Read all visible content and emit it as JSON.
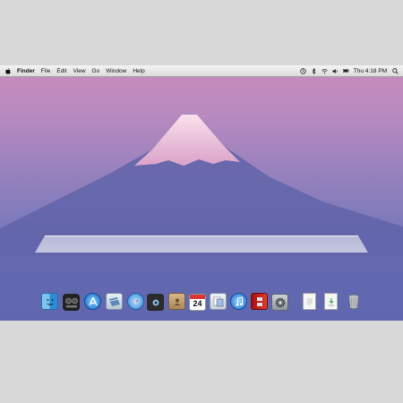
{
  "menubar": {
    "app_name": "Finder",
    "items": [
      "File",
      "Edit",
      "View",
      "Go",
      "Window",
      "Help"
    ],
    "clock": "Thu 4:18 PM"
  },
  "status_icons": [
    "time-machine-icon",
    "bluetooth-icon",
    "wifi-icon",
    "volume-icon",
    "battery-icon",
    "spotlight-icon"
  ],
  "desktop": {
    "wallpaper": "Mount Fuji",
    "sky_color": "#c98bb8",
    "mountain_color": "#5e66ad",
    "snow_color": "#f2c6dc"
  },
  "dock": {
    "calendar_day": "24",
    "icons": [
      "finder-icon",
      "dashboard-icon",
      "app-store-icon",
      "mail-icon",
      "safari-icon",
      "facetime-icon",
      "address-book-icon",
      "calendar-icon",
      "preview-icon",
      "itunes-icon",
      "photo-booth-icon",
      "system-preferences-icon",
      "document-icon",
      "downloads-icon",
      "trash-icon"
    ]
  }
}
